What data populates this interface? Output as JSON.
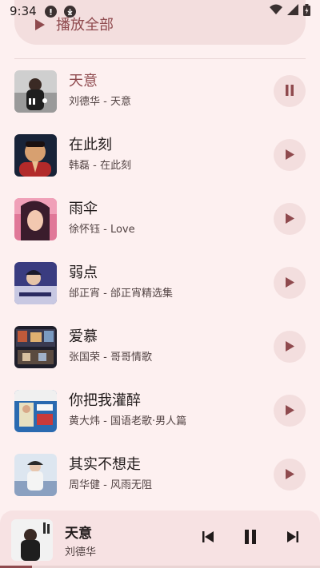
{
  "status_bar": {
    "time": "9:34",
    "icons": [
      "alert-icon",
      "download-icon",
      "wifi-icon",
      "signal-icon",
      "battery-icon"
    ]
  },
  "play_all": {
    "label": "播放全部",
    "icon": "play-icon"
  },
  "songs": [
    {
      "title": "天意",
      "subtitle": "刘德华 - 天意",
      "playing": true,
      "cover_colors": [
        "#c9c9c9",
        "#2e2e2e"
      ]
    },
    {
      "title": "在此刻",
      "subtitle": "韩磊 - 在此刻",
      "playing": false,
      "cover_colors": [
        "#1a2a4a",
        "#d7a070"
      ]
    },
    {
      "title": "雨伞",
      "subtitle": "徐怀钰 - Love",
      "playing": false,
      "cover_colors": [
        "#e06a8a",
        "#3a1c2c"
      ]
    },
    {
      "title": "弱点",
      "subtitle": "邰正宵 - 邰正宵精选集",
      "playing": false,
      "cover_colors": [
        "#3a3a7a",
        "#c8c8e0"
      ]
    },
    {
      "title": "爱慕",
      "subtitle": "张国荣 - 哥哥情歌",
      "playing": false,
      "cover_colors": [
        "#2a2a3a",
        "#c05a3a"
      ]
    },
    {
      "title": "你把我灌醉",
      "subtitle": "黄大炜 - 国语老歌·男人篇",
      "playing": false,
      "cover_colors": [
        "#2a6ab0",
        "#f0f0f0"
      ]
    },
    {
      "title": "其实不想走",
      "subtitle": "周华健 - 风雨无阻",
      "playing": false,
      "cover_colors": [
        "#d8e4f0",
        "#6080a8"
      ]
    }
  ],
  "mini_player": {
    "title": "天意",
    "artist": "刘德华",
    "progress": 0.1
  },
  "colors": {
    "background": "#fdf0f0",
    "accent": "#8f4a4e",
    "button_bg": "#f3dede"
  }
}
